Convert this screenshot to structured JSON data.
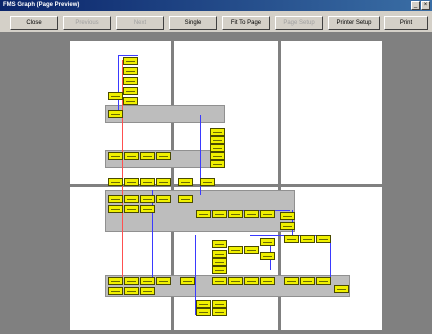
{
  "window": {
    "title": "FMS Graph (Page Preview)"
  },
  "toolbar": {
    "close_label": "Close",
    "previous_label": "Previous",
    "next_label": "Next",
    "single_label": "Single",
    "fit_label": "Fit To Page",
    "page_setup_label": "Page Setup",
    "printer_setup_label": "Printer Setup",
    "print_label": "Print"
  }
}
